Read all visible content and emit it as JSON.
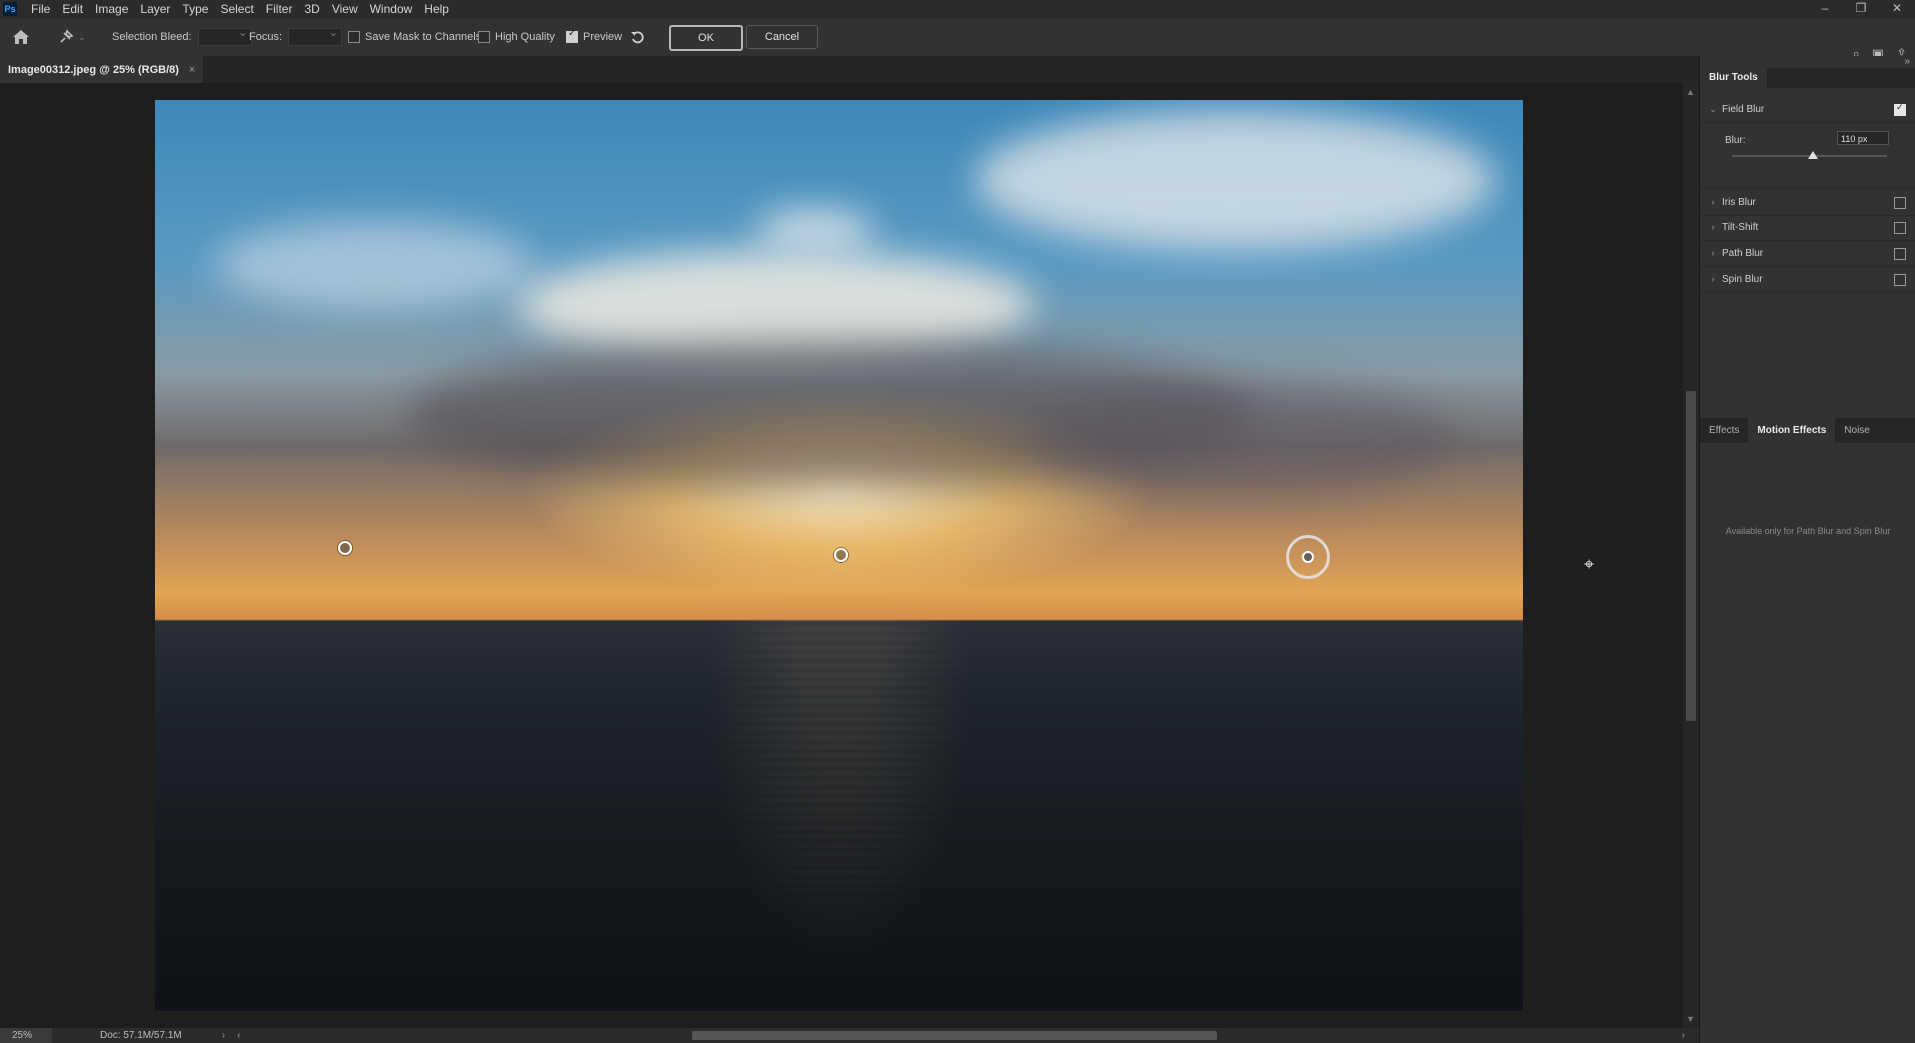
{
  "menu": {
    "logo": "Ps",
    "items": [
      "File",
      "Edit",
      "Image",
      "Layer",
      "Type",
      "Select",
      "Filter",
      "3D",
      "View",
      "Window",
      "Help"
    ]
  },
  "window_controls": [
    "–",
    "❐",
    "✕"
  ],
  "options_bar": {
    "selection_bleed_label": "Selection Bleed:",
    "focus_label": "Focus:",
    "save_mask_label": "Save Mask to Channels",
    "high_quality_label": "High Quality",
    "preview_label": "Preview",
    "preview_checked": true,
    "ok_label": "OK",
    "cancel_label": "Cancel",
    "home_icon": "home-icon",
    "pin_tool_icon": "pin-tool-icon",
    "reset_icon": "undo-icon"
  },
  "document": {
    "tab_title": "Image00312.jpeg @ 25% (RGB/8)",
    "close_glyph": "×"
  },
  "status": {
    "zoom": "25%",
    "doc": "Doc: 57.1M/57.1M",
    "arrow": "›",
    "scroll_left": "‹",
    "scroll_right": "›"
  },
  "panel": {
    "collapse_glyph": "»",
    "title": "Blur Tools",
    "sections": [
      {
        "label": "Field Blur",
        "expanded": true,
        "checked": true
      },
      {
        "label": "Iris Blur",
        "expanded": false,
        "checked": false
      },
      {
        "label": "Tilt-Shift",
        "expanded": false,
        "checked": false
      },
      {
        "label": "Path Blur",
        "expanded": false,
        "checked": false
      },
      {
        "label": "Spin Blur",
        "expanded": false,
        "checked": false
      }
    ],
    "blur_label": "Blur:",
    "blur_value": "110 px",
    "blur_fraction": 0.52,
    "effect_tabs": [
      "Effects",
      "Motion Effects",
      "Noise"
    ],
    "active_effect_tab": "Motion Effects",
    "effects_note": "Available only for Path Blur and Spin Blur"
  },
  "colors": {
    "accent": "#31a8ff",
    "panel_bg": "#323232",
    "workspace_bg": "#1e1e1e"
  }
}
